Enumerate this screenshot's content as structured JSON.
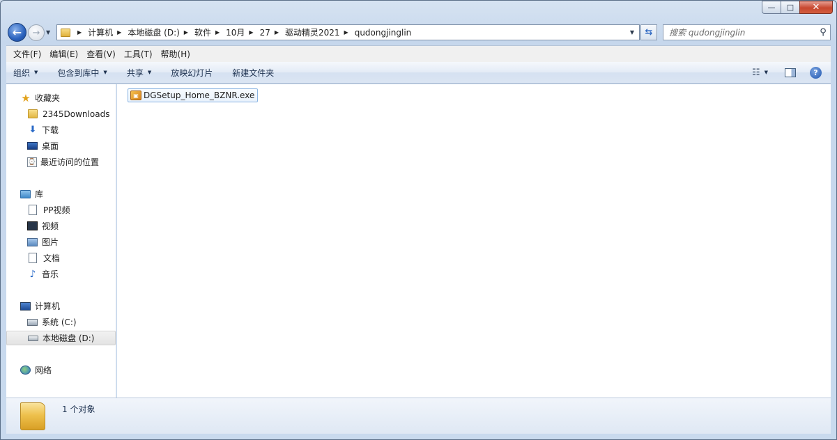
{
  "titlebar": {
    "minimize": "—",
    "maximize": "□",
    "close": "✕"
  },
  "nav": {
    "back": "←",
    "forward": "→"
  },
  "address": {
    "breadcrumbs": [
      "计算机",
      "本地磁盘 (D:)",
      "软件",
      "10月",
      "27",
      "驱动精灵2021",
      "qudongjinglin"
    ]
  },
  "search": {
    "placeholder": "搜索 qudongjinglin"
  },
  "menubar": {
    "items": [
      "文件(F)",
      "编辑(E)",
      "查看(V)",
      "工具(T)",
      "帮助(H)"
    ]
  },
  "commandbar": {
    "organize": "组织",
    "include_in_library": "包含到库中",
    "share": "共享",
    "slideshow": "放映幻灯片",
    "new_folder": "新建文件夹"
  },
  "navpane": {
    "favorites": {
      "label": "收藏夹",
      "items": [
        "2345Downloads",
        "下载",
        "桌面",
        "最近访问的位置"
      ]
    },
    "libraries": {
      "label": "库",
      "items": [
        "PP视频",
        "视频",
        "图片",
        "文档",
        "音乐"
      ]
    },
    "computer": {
      "label": "计算机",
      "items": [
        "系统 (C:)",
        "本地磁盘 (D:)"
      ]
    },
    "network": {
      "label": "网络"
    }
  },
  "files": [
    {
      "name": "DGSetup_Home_BZNR.exe"
    }
  ],
  "details": {
    "status": "1 个对象"
  }
}
